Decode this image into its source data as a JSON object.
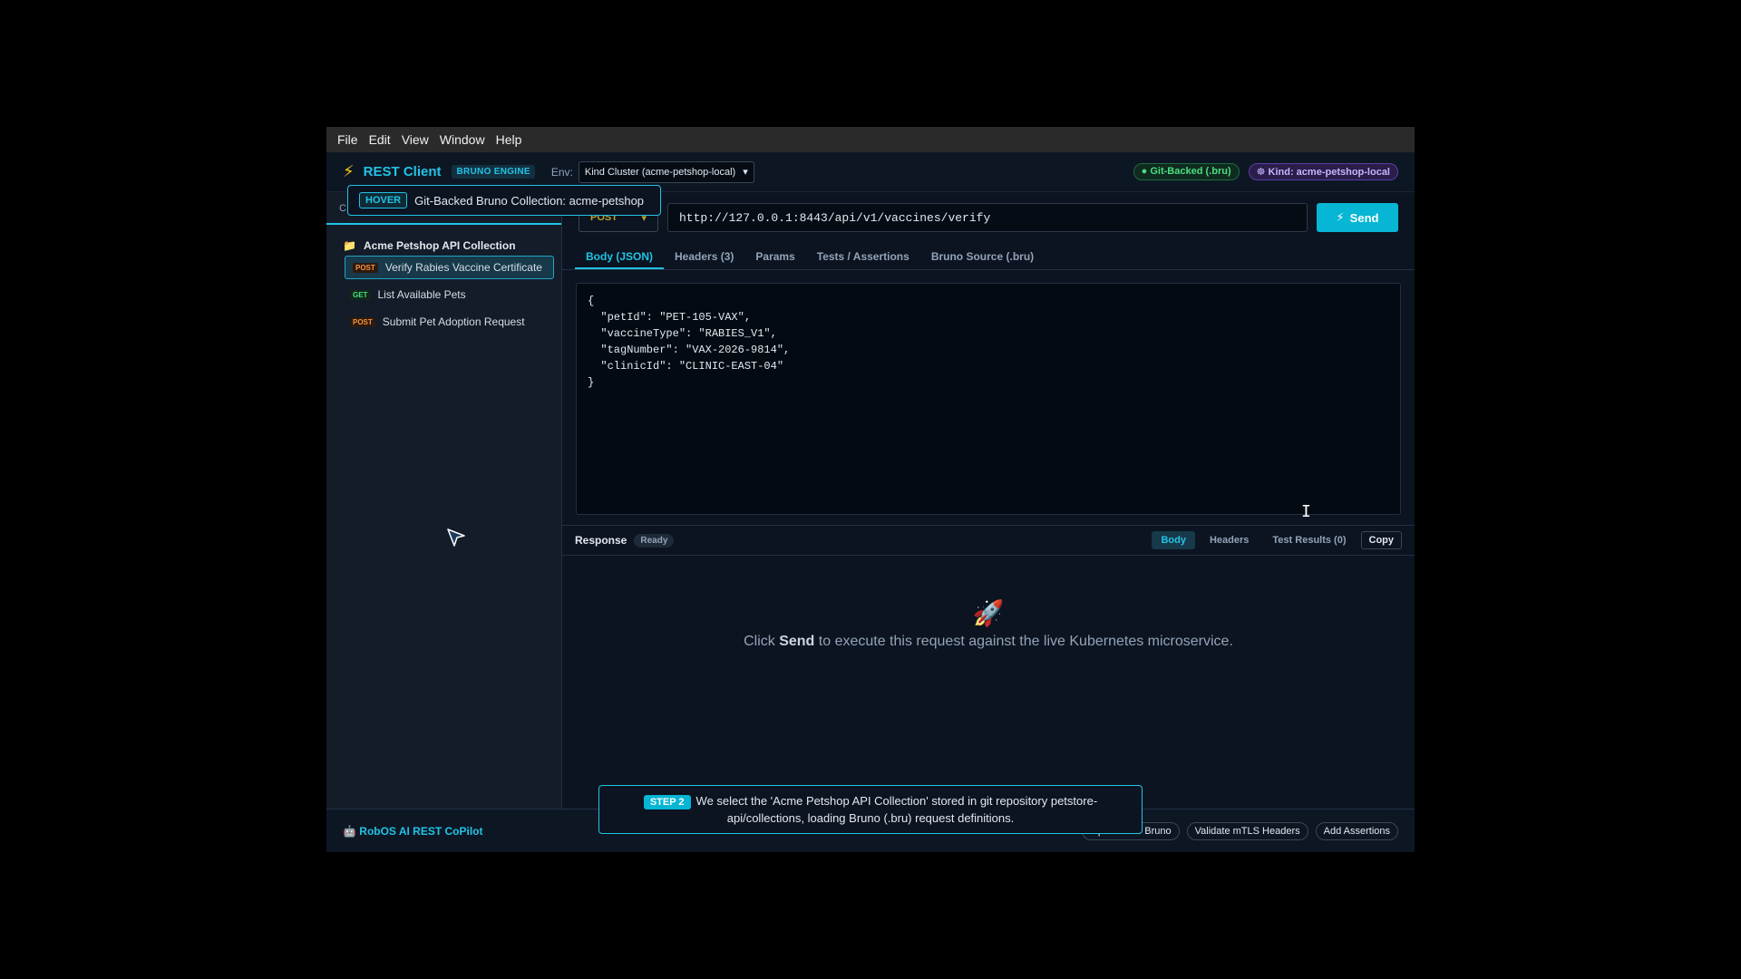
{
  "menu": [
    "File",
    "Edit",
    "View",
    "Window",
    "Help"
  ],
  "header": {
    "title": "REST Client",
    "engine_badge": "BRUNO ENGINE",
    "env_label": "Env:",
    "env_value": "Kind Cluster (acme-petshop-local)",
    "git_badge": "● Git-Backed (.bru)",
    "kind_badge": "☸ Kind: acme-petshop-local"
  },
  "hover_tip": {
    "badge": "HOVER",
    "text": "Git-Backed Bruno Collection: acme-petshop"
  },
  "sidebar": {
    "tab_label": "C",
    "collection": "Acme Petshop API Collection",
    "items": [
      {
        "method": "POST",
        "label": "Verify Rabies Vaccine Certificate"
      },
      {
        "method": "GET",
        "label": "List Available Pets"
      },
      {
        "method": "POST",
        "label": "Submit Pet Adoption Request"
      }
    ]
  },
  "request": {
    "method": "POST",
    "url": "http://127.0.0.1:8443/api/v1/vaccines/verify",
    "send_label": "Send",
    "tabs": [
      "Body (JSON)",
      "Headers (3)",
      "Params",
      "Tests / Assertions",
      "Bruno Source (.bru)"
    ],
    "body": "{\n  \"petId\": \"PET-105-VAX\",\n  \"vaccineType\": \"RABIES_V1\",\n  \"tagNumber\": \"VAX-2026-9814\",\n  \"clinicId\": \"CLINIC-EAST-04\"\n}"
  },
  "response": {
    "title": "Response",
    "status": "Ready",
    "tabs": [
      "Body",
      "Headers",
      "Test Results (0)"
    ],
    "copy_label": "Copy",
    "empty_pre": "Click ",
    "empty_bold": "Send",
    "empty_post": " to execute this request against the live Kubernetes microservice."
  },
  "footer": {
    "copilot": "🤖 RobOS AI REST CoPilot",
    "buttons": [
      "OpenAPI to Bruno",
      "Validate mTLS Headers",
      "Add Assertions"
    ]
  },
  "step": {
    "badge": "STEP 2",
    "text": "We select the 'Acme Petshop API Collection' stored in git repository petstore-api/collections, loading Bruno (.bru) request definitions."
  },
  "colors": {
    "accent": "#22c3e6",
    "background": "#0b1420",
    "post": "#fb923c",
    "get": "#4ade80"
  }
}
